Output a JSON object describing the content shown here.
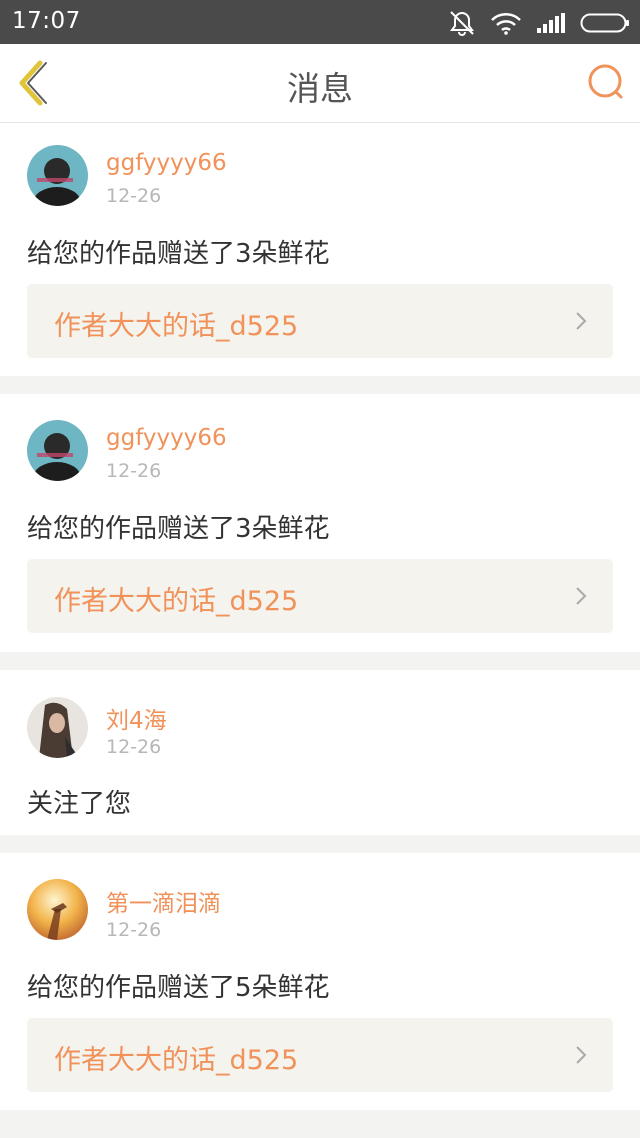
{
  "status_bar": {
    "time": "17:07",
    "icons": [
      "mute-icon",
      "wifi-icon",
      "signal-icon",
      "battery-icon"
    ]
  },
  "nav": {
    "title": "消息",
    "back_icon": "chevron-left-icon",
    "search_icon": "search-icon"
  },
  "colors": {
    "accent": "#f0925a",
    "back_icon": "#e2c43a",
    "status_bar": "#4a4a4a"
  },
  "messages": [
    {
      "user": "ggfyyyy66",
      "date": "12-26",
      "text": "给您的作品赠送了3朵鲜花",
      "work": "作者大大的话_d525"
    },
    {
      "user": "ggfyyyy66",
      "date": "12-26",
      "text": "给您的作品赠送了3朵鲜花",
      "work": "作者大大的话_d525"
    },
    {
      "user": "刘4海",
      "date": "12-26",
      "text": "关注了您"
    },
    {
      "user": "第一滴泪滴",
      "date": "12-26",
      "text": "给您的作品赠送了5朵鲜花",
      "work": "作者大大的话_d525"
    }
  ]
}
